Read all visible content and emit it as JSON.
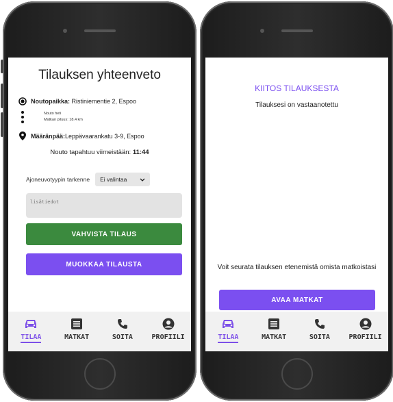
{
  "summary_screen": {
    "title": "Tilauksen yhteenveto",
    "pickup_label": "Noutopaikka:",
    "pickup_value": " Ristiniementie 2, Espoo",
    "pickup_time": "Nouto heti",
    "trip_length": "Matkan pituus: 18.4 km",
    "destination_label": "Määränpää:",
    "destination_value": "Leppävaarankatu 3-9, Espoo",
    "deadline_text": "Nouto tapahtuu viimeistään: ",
    "deadline_time": "11:44",
    "vehicle_label": "Ajoneuvotyypin tarkenne",
    "vehicle_selected": "Ei valintaa",
    "extra_placeholder": "lisätiedot",
    "confirm_button": "VAHVISTA TILAUS",
    "edit_button": "MUOKKAA TILAUSTA"
  },
  "thanks_screen": {
    "title": "KIITOS TILAUKSESTA",
    "subtitle": "Tilauksesi on vastaanotettu",
    "follow_text": "Voit seurata tilauksen etenemistä omista matkoistasi",
    "open_button": "AVAA MATKAT"
  },
  "nav": {
    "order": "TILAA",
    "trips": "MATKAT",
    "call": "SOITA",
    "profile": "PROFIILI"
  },
  "colors": {
    "accent": "#7b4ff0",
    "confirm": "#3b8a3e",
    "nav_background": "#f1f1f1"
  },
  "icons": {
    "order": "car-icon",
    "trips": "list-icon",
    "call": "phone-icon",
    "profile": "user-icon",
    "pickup": "target-icon",
    "route": "dots-icon",
    "destination": "map-pin-icon"
  }
}
